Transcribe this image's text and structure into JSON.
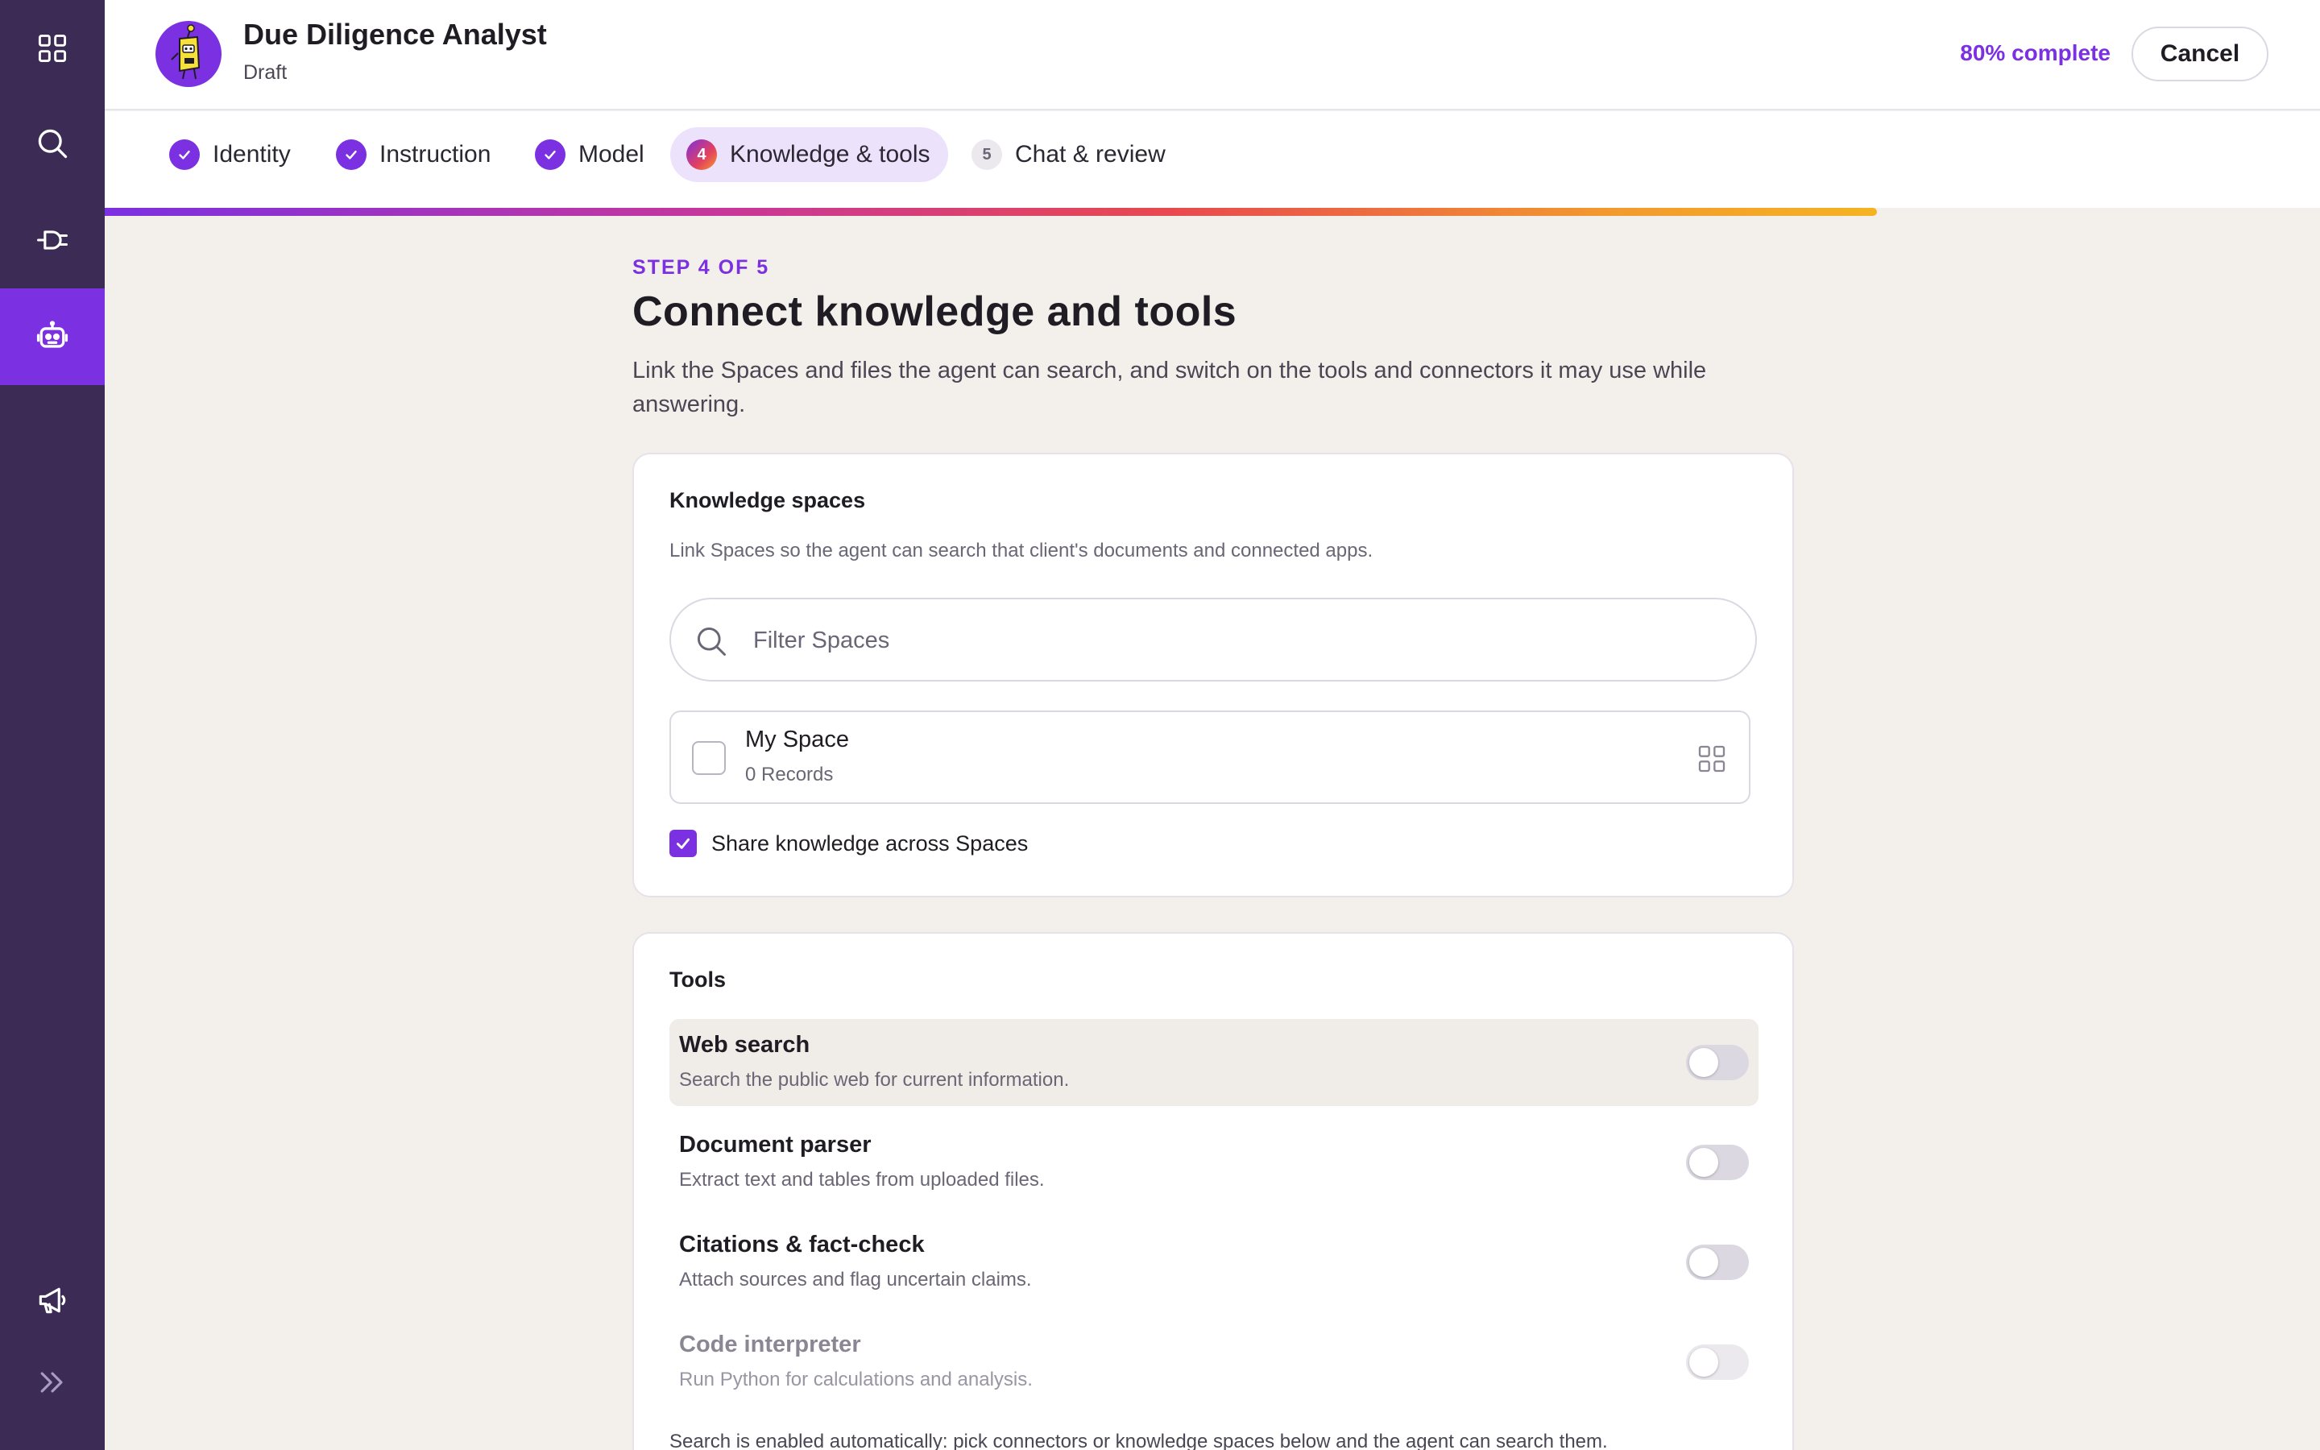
{
  "sidebar": {
    "items": [
      {
        "icon": "apps-grid-icon"
      },
      {
        "icon": "search-icon"
      },
      {
        "icon": "connector-plug-icon"
      },
      {
        "icon": "robot-icon",
        "active": true
      },
      {
        "icon": "megaphone-icon"
      },
      {
        "icon": "expand-chevrons-icon"
      }
    ]
  },
  "header": {
    "title": "Due Diligence Analyst",
    "status": "Draft",
    "progress_label": "80% complete",
    "progress": 0.8,
    "cancel_label": "Cancel"
  },
  "steps": [
    {
      "label": "Identity",
      "state": "done"
    },
    {
      "label": "Instruction",
      "state": "done"
    },
    {
      "label": "Model",
      "state": "done"
    },
    {
      "label": "Knowledge & tools",
      "state": "current",
      "number": "4"
    },
    {
      "label": "Chat & review",
      "state": "todo",
      "number": "5"
    }
  ],
  "page": {
    "eyebrow": "STEP 4 OF 5",
    "title": "Connect knowledge and tools",
    "description": "Link the Spaces and files the agent can search, and switch on the tools and connectors it may use while answering."
  },
  "knowledge": {
    "title": "Knowledge spaces",
    "description": "Link Spaces so the agent can search that client's documents and connected apps.",
    "filter_placeholder": "Filter Spaces",
    "spaces": [
      {
        "name": "My Space",
        "meta": "0 Records",
        "checked": false
      }
    ],
    "share_label": "Share knowledge across Spaces",
    "share_checked": true
  },
  "tools": {
    "title": "Tools",
    "items": [
      {
        "name": "Web search",
        "description": "Search the public web for current information.",
        "enabled": false
      },
      {
        "name": "Document parser",
        "description": "Extract text and tables from uploaded files.",
        "enabled": false
      },
      {
        "name": "Citations & fact-check",
        "description": "Attach sources and flag uncertain claims.",
        "enabled": false
      },
      {
        "name": "Code interpreter",
        "description": "Run Python for calculations and analysis.",
        "enabled": false,
        "disabled": true
      }
    ],
    "footnote": "Search is enabled automatically: pick connectors or knowledge spaces below and the agent can search them."
  },
  "colors": {
    "accent": "#7b30e2",
    "sidebar": "#3b2b55",
    "background": "#f3f0ec"
  }
}
